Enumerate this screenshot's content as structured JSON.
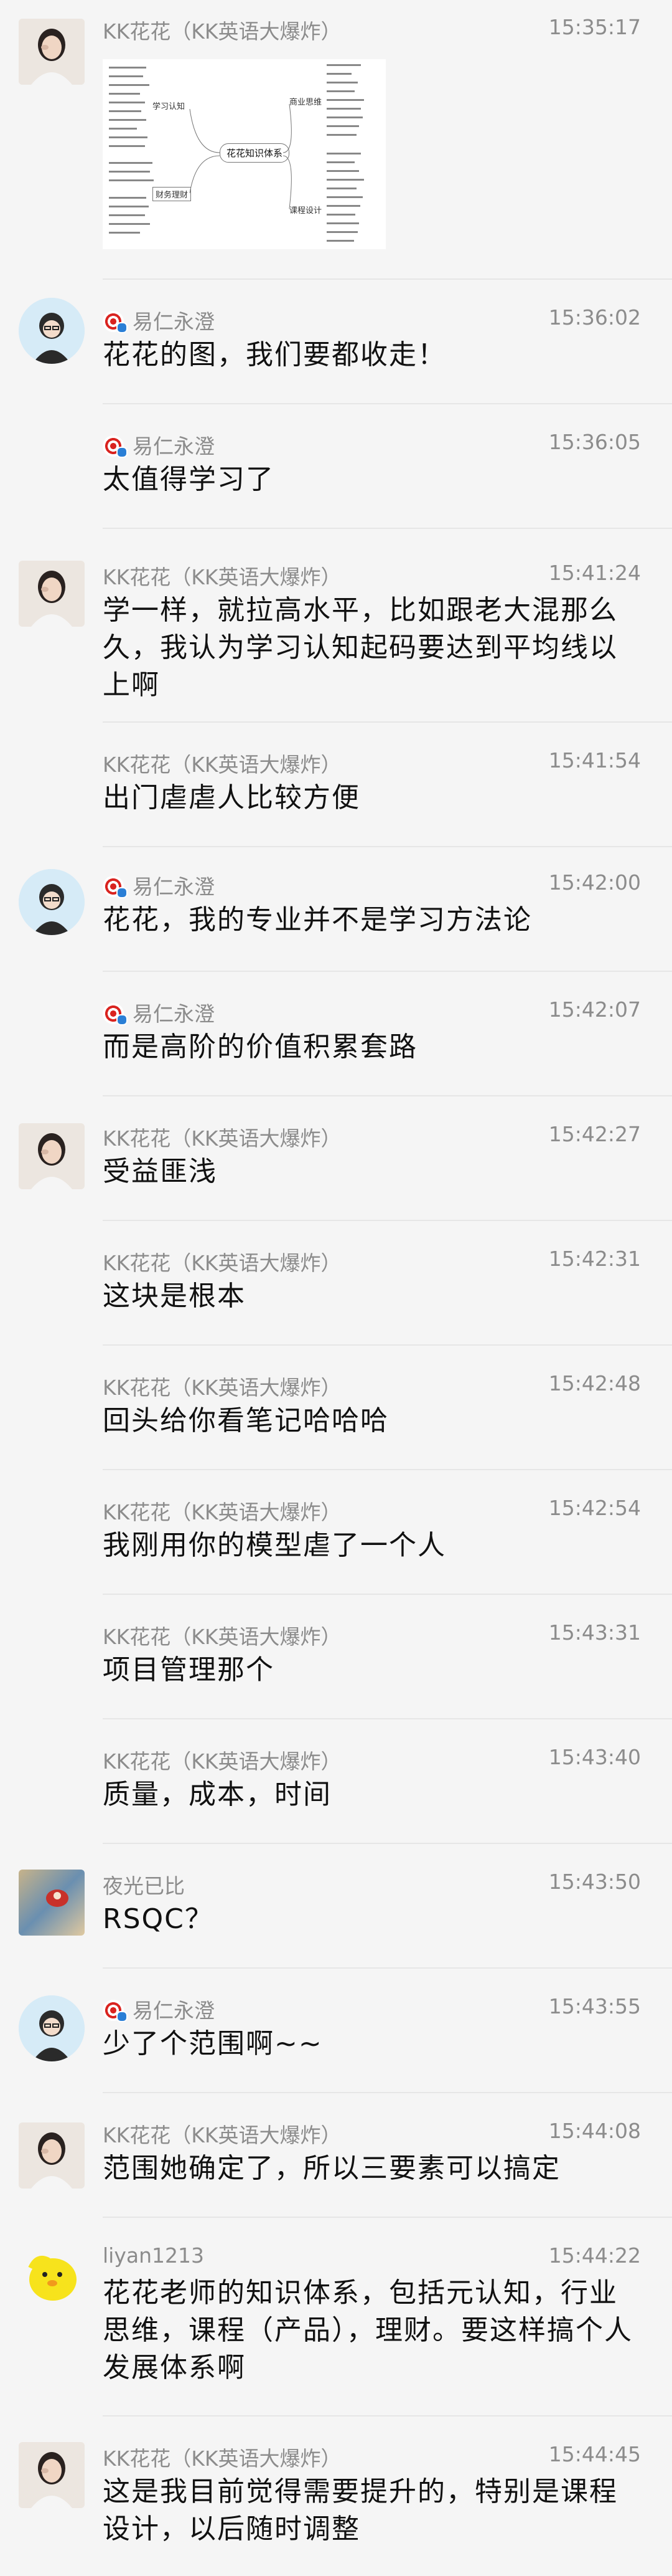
{
  "messages": [
    {
      "avatar": "kk-avatar",
      "name": "KK花花（KK英语大爆炸）",
      "time": "15:35:17",
      "type": "image",
      "mindmap": {
        "center": "花花知识体系",
        "nodes": [
          "学习认知",
          "商业思维",
          "课程设计",
          "财务理财"
        ]
      }
    },
    {
      "avatar": "yiren-avatar",
      "name": "易仁永澄",
      "time": "15:36:02",
      "text": "花花的图，我们要都收走！"
    },
    {
      "avatar": null,
      "name": "易仁永澄",
      "time": "15:36:05",
      "text": "太值得学习了"
    },
    {
      "avatar": "kk-avatar",
      "name": "KK花花（KK英语大爆炸）",
      "time": "15:41:24",
      "text": "学一样，就拉高水平，比如跟老大混那么久，我认为学习认知起码要达到平均线以上啊"
    },
    {
      "avatar": null,
      "name": "KK花花（KK英语大爆炸）",
      "time": "15:41:54",
      "text": "出门虐虐人比较方便"
    },
    {
      "avatar": "yiren-avatar",
      "name": "易仁永澄",
      "time": "15:42:00",
      "text": "花花，我的专业并不是学习方法论"
    },
    {
      "avatar": null,
      "name": "易仁永澄",
      "time": "15:42:07",
      "text": "而是高阶的价值积累套路"
    },
    {
      "avatar": "kk-avatar",
      "name": "KK花花（KK英语大爆炸）",
      "time": "15:42:27",
      "text": "受益匪浅"
    },
    {
      "avatar": null,
      "name": "KK花花（KK英语大爆炸）",
      "time": "15:42:31",
      "text": "这块是根本"
    },
    {
      "avatar": null,
      "name": "KK花花（KK英语大爆炸）",
      "time": "15:42:48",
      "text": "回头给你看笔记哈哈哈"
    },
    {
      "avatar": null,
      "name": "KK花花（KK英语大爆炸）",
      "time": "15:42:54",
      "text": "我刚用你的模型虐了一个人"
    },
    {
      "avatar": null,
      "name": "KK花花（KK英语大爆炸）",
      "time": "15:43:31",
      "text": "项目管理那个"
    },
    {
      "avatar": null,
      "name": "KK花花（KK英语大爆炸）",
      "time": "15:43:40",
      "text": "质量，成本，时间"
    },
    {
      "avatar": "yeguang-avatar",
      "name": "夜光已比",
      "time": "15:43:50",
      "text": "RSQC？"
    },
    {
      "avatar": "yiren-avatar",
      "name": "易仁永澄",
      "time": "15:43:55",
      "text": "少了个范围啊~~"
    },
    {
      "avatar": "kk-avatar",
      "name": "KK花花（KK英语大爆炸）",
      "time": "15:44:08",
      "text": "范围她确定了，所以三要素可以搞定"
    },
    {
      "avatar": "liyan-avatar",
      "name": "liyan1213",
      "time": "15:44:22",
      "text": "花花老师的知识体系，包括元认知，行业思维，课程（产品），理财。要这样搞个人发展体系啊"
    },
    {
      "avatar": "kk-avatar",
      "name": "KK花花（KK英语大爆炸）",
      "time": "15:44:45",
      "text": "这是我目前觉得需要提升的，特别是课程设计，以后随时调整"
    }
  ]
}
